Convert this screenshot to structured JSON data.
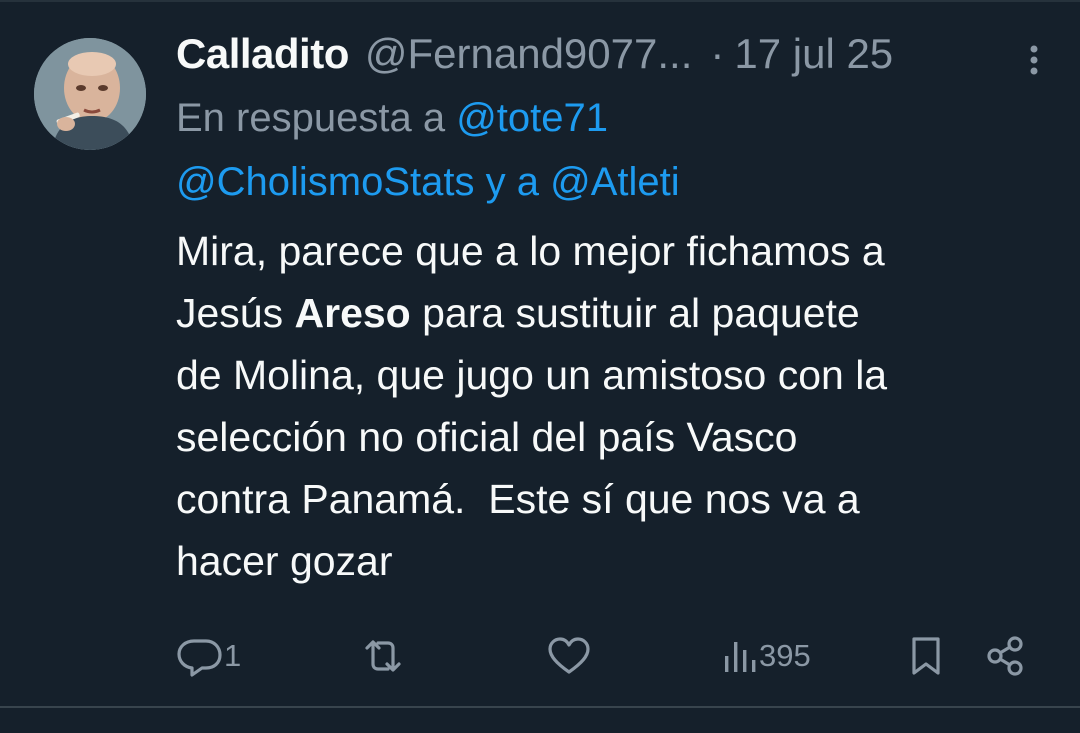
{
  "tweet": {
    "display_name": "Calladito",
    "handle": "@Fernand9077...",
    "separator": "·",
    "date": "17 jul 25",
    "reply_prefix": "En respuesta a",
    "mention_1": "@tote71",
    "mention_2": "@CholismoStats",
    "reply_and": "y a",
    "mention_3": "@Atleti",
    "body_part1": "Mira, parece que a lo mejor fichamos a\nJesús ",
    "body_bold": "Areso",
    "body_part2": " para sustituir al paquete\nde Molina, que jugo un amistoso con la\nselección no oficial del país Vasco\ncontra Panamá.  Este sí que nos va a\nhacer gozar"
  },
  "actions": {
    "reply_count": "1",
    "views_count": "395"
  },
  "icons": {
    "avatar": "avatar-image",
    "more": "more-vertical-icon",
    "reply": "reply-bubble-icon",
    "retweet": "retweet-icon",
    "like": "heart-icon",
    "views": "bar-chart-icon",
    "bookmark": "bookmark-icon",
    "share": "share-icon"
  },
  "colors": {
    "background": "#15202b",
    "text_primary": "#f7f9f9",
    "text_secondary": "#8b98a5",
    "accent": "#1d9bf0"
  }
}
